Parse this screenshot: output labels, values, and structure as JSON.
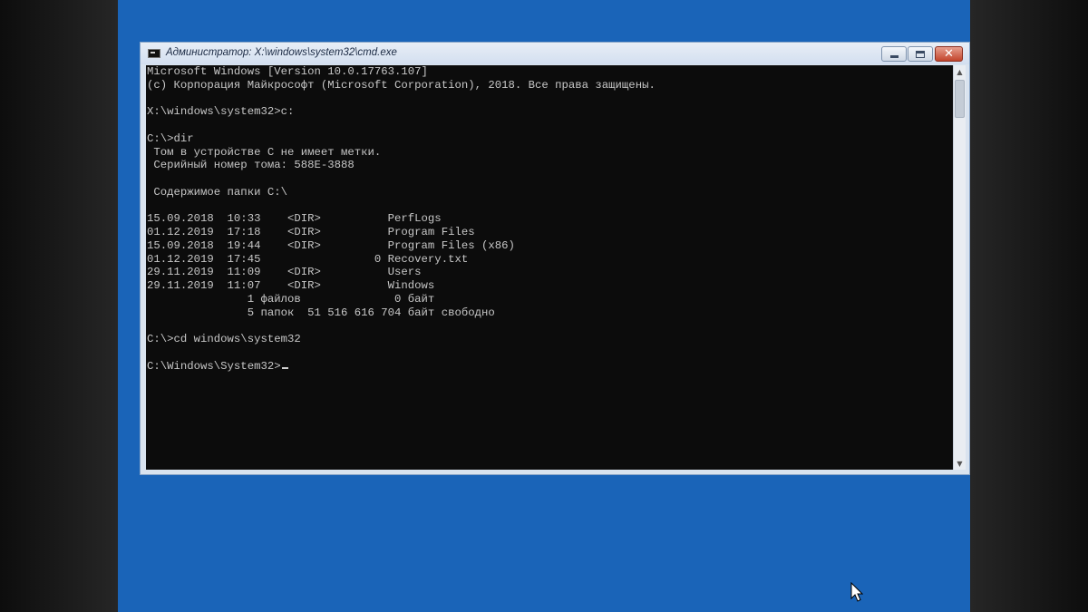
{
  "window": {
    "title": "Администратор: X:\\windows\\system32\\cmd.exe",
    "buttons": {
      "minimize": "minimize",
      "maximize": "maximize",
      "close": "close"
    }
  },
  "console": {
    "lines": [
      "Microsoft Windows [Version 10.0.17763.107]",
      "(c) Корпорация Майкрософт (Microsoft Corporation), 2018. Все права защищены.",
      "",
      "X:\\windows\\system32>c:",
      "",
      "C:\\>dir",
      " Том в устройстве C не имеет метки.",
      " Серийный номер тома: 588E-3888",
      "",
      " Содержимое папки C:\\",
      "",
      "15.09.2018  10:33    <DIR>          PerfLogs",
      "01.12.2019  17:18    <DIR>          Program Files",
      "15.09.2018  19:44    <DIR>          Program Files (x86)",
      "01.12.2019  17:45                 0 Recovery.txt",
      "29.11.2019  11:09    <DIR>          Users",
      "29.11.2019  11:07    <DIR>          Windows",
      "               1 файлов              0 байт",
      "               5 папок  51 516 616 704 байт свободно",
      "",
      "C:\\>cd windows\\system32",
      "",
      "C:\\Windows\\System32>"
    ]
  },
  "colors": {
    "desktop": "#1a64b8",
    "console_bg": "#0c0c0c",
    "console_text": "#c7c7c7"
  },
  "icons": {
    "title": "cmd-icon",
    "scroll_up": "scroll-up-arrow-icon",
    "scroll_down": "scroll-down-arrow-icon",
    "pointer": "mouse-pointer-icon"
  }
}
